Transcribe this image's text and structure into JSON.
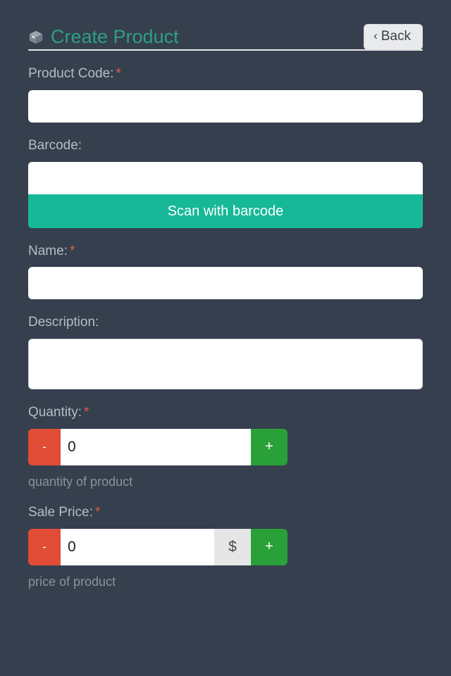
{
  "header": {
    "icon": "box-icon",
    "title": "Create Product",
    "back_label": "Back",
    "back_chevron": "‹"
  },
  "form": {
    "required_marker": "*",
    "fields": [
      {
        "name": "product_code",
        "label": "Product Code:",
        "required": true,
        "value": "",
        "placeholder": ""
      },
      {
        "name": "barcode",
        "label": "Barcode:",
        "required": false,
        "value": "",
        "placeholder": "",
        "scan_button_label": "Scan with barcode"
      },
      {
        "name": "name",
        "label": "Name:",
        "required": true,
        "value": "",
        "placeholder": ""
      },
      {
        "name": "description",
        "label": "Description:",
        "required": false,
        "value": "",
        "placeholder": ""
      },
      {
        "name": "quantity",
        "label": "Quantity:",
        "required": true,
        "value": "0",
        "help": "quantity of product",
        "minus_label": "-",
        "plus_label": "+"
      },
      {
        "name": "sale_price",
        "label": "Sale Price:",
        "required": true,
        "value": "0",
        "help": "price of product",
        "minus_label": "-",
        "plus_label": "+",
        "currency_symbol": "$"
      }
    ]
  },
  "colors": {
    "background": "#353f4e",
    "title": "#2f9e87",
    "accent_teal": "#17b897",
    "minus_red": "#e04c36",
    "plus_green": "#2aa038",
    "label": "#b6bcc5",
    "required": "#e15c4a",
    "help": "#8a929c",
    "addon_gray": "#e6e6e6",
    "back_button_bg": "#e9eaec"
  }
}
